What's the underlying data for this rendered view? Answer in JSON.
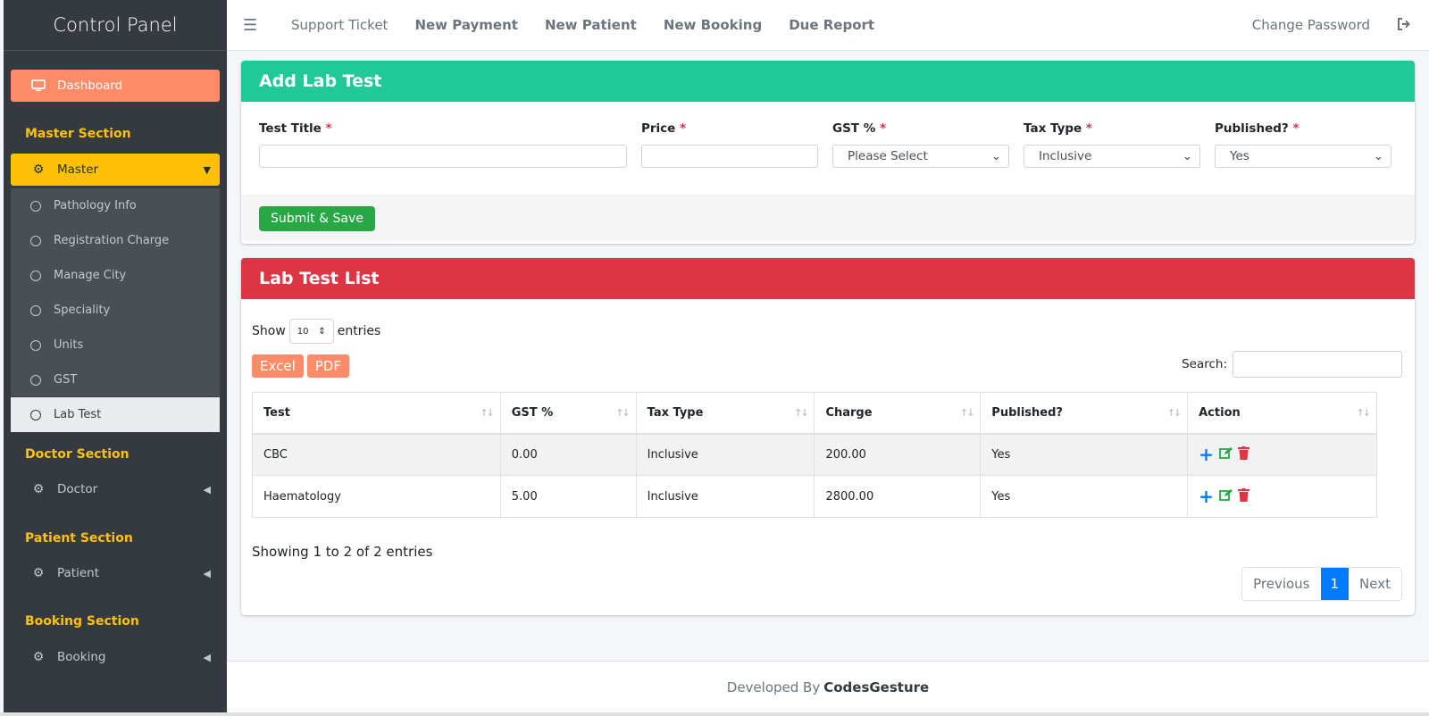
{
  "sidebar": {
    "brand": "Control Panel",
    "dashboard": "Dashboard",
    "sections": {
      "master": "Master Section",
      "doctor": "Doctor Section",
      "patient": "Patient Section",
      "booking": "Booking Section"
    },
    "master_label": "Master",
    "master_items": [
      "Pathology Info",
      "Registration Charge",
      "Manage City",
      "Speciality",
      "Units",
      "GST",
      "Lab Test"
    ],
    "doctor_label": "Doctor",
    "patient_label": "Patient",
    "booking_label": "Booking"
  },
  "topbar": {
    "links": [
      "Support Ticket",
      "New Payment",
      "New Patient",
      "New Booking",
      "Due Report"
    ],
    "change_password": "Change Password"
  },
  "add_card": {
    "title": "Add Lab Test",
    "fields": {
      "test_title": "Test Title",
      "price": "Price",
      "gst": "GST %",
      "tax_type": "Tax Type",
      "published": "Published?"
    },
    "gst_value": "Please Select",
    "tax_type_value": "Inclusive",
    "published_value": "Yes",
    "required_mark": "*",
    "submit": "Submit & Save"
  },
  "list_card": {
    "title": "Lab Test List",
    "show": "Show",
    "entries_value": "10",
    "entries": "entries",
    "excel": "Excel",
    "pdf": "PDF",
    "search": "Search:",
    "columns": [
      "Test",
      "GST %",
      "Tax Type",
      "Charge",
      "Published?",
      "Action"
    ],
    "rows": [
      [
        "CBC",
        "0.00",
        "Inclusive",
        "200.00",
        "Yes"
      ],
      [
        "Haematology",
        "5.00",
        "Inclusive",
        "2800.00",
        "Yes"
      ]
    ],
    "info": "Showing 1 to 2 of 2 entries",
    "previous": "Previous",
    "page": "1",
    "next": "Next"
  },
  "footer": {
    "developed_by": "Developed By",
    "company": "CodesGesture"
  }
}
